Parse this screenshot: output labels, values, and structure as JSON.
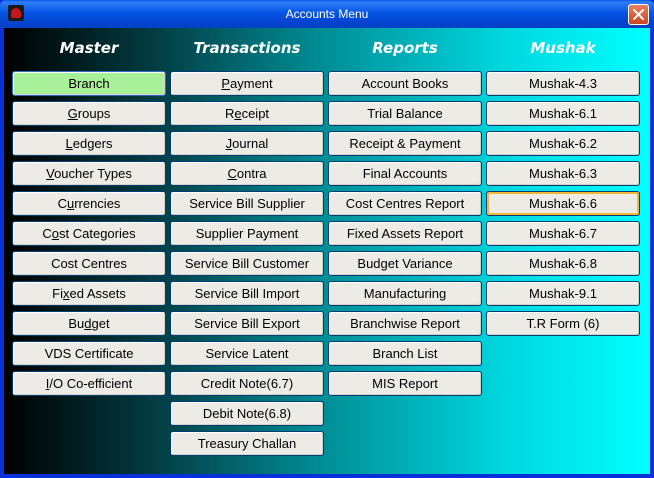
{
  "window": {
    "title": "Accounts Menu"
  },
  "columns": [
    {
      "header": "Master",
      "items": [
        {
          "label": "Branch",
          "selected": true
        },
        {
          "label": "Groups",
          "underline": "G"
        },
        {
          "label": "Ledgers",
          "underline": "L"
        },
        {
          "label": "Voucher Types",
          "underline": "V"
        },
        {
          "label": "Currencies",
          "underline": "u"
        },
        {
          "label": "Cost Categories",
          "underline": "o"
        },
        {
          "label": "Cost Centres"
        },
        {
          "label": "Fixed Assets",
          "underline": "x"
        },
        {
          "label": "Budget",
          "underline": "d"
        },
        {
          "label": "VDS Certificate"
        },
        {
          "label": "I/O Co-efficient",
          "underline": "I"
        }
      ]
    },
    {
      "header": "Transactions",
      "items": [
        {
          "label": "Payment",
          "underline": "P"
        },
        {
          "label": "Receipt",
          "underline": "e"
        },
        {
          "label": "Journal",
          "underline": "J"
        },
        {
          "label": "Contra",
          "underline": "C"
        },
        {
          "label": "Service Bill Supplier"
        },
        {
          "label": "Supplier Payment"
        },
        {
          "label": "Service Bill Customer"
        },
        {
          "label": "Service Bill Import"
        },
        {
          "label": "Service Bill Export"
        },
        {
          "label": "Service Latent"
        },
        {
          "label": "Credit Note(6.7)"
        },
        {
          "label": "Debit Note(6.8)"
        },
        {
          "label": "Treasury Challan"
        }
      ]
    },
    {
      "header": "Reports",
      "items": [
        {
          "label": "Account Books"
        },
        {
          "label": "Trial Balance"
        },
        {
          "label": "Receipt & Payment"
        },
        {
          "label": "Final Accounts"
        },
        {
          "label": "Cost Centres Report"
        },
        {
          "label": "Fixed Assets Report"
        },
        {
          "label": "Budget Variance"
        },
        {
          "label": "Manufacturing"
        },
        {
          "label": "Branchwise Report"
        },
        {
          "label": "Branch List"
        },
        {
          "label": "MIS Report"
        }
      ]
    },
    {
      "header": "Mushak",
      "items": [
        {
          "label": "Mushak-4.3"
        },
        {
          "label": "Mushak-6.1"
        },
        {
          "label": "Mushak-6.2"
        },
        {
          "label": "Mushak-6.3"
        },
        {
          "label": "Mushak-6.6",
          "hover": true
        },
        {
          "label": "Mushak-6.7"
        },
        {
          "label": "Mushak-6.8"
        },
        {
          "label": "Mushak-9.1"
        },
        {
          "label": "T.R Form (6)"
        }
      ]
    }
  ],
  "colors": {
    "selected": "#a9f09a",
    "hover_border": "#f8b636",
    "title_bar": "#0655e4",
    "close": "#cc4520"
  },
  "icons": {
    "app": "app-icon",
    "close": "close-icon"
  }
}
